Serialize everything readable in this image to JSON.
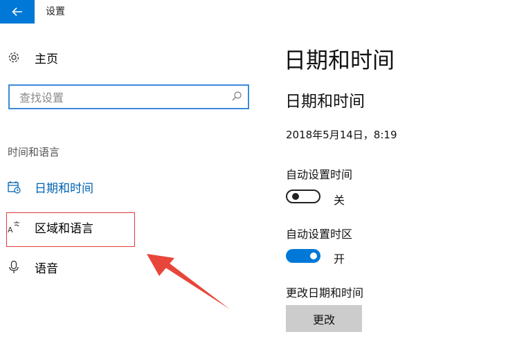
{
  "window": {
    "title": "设置"
  },
  "sidebar": {
    "home_label": "主页",
    "search_placeholder": "查找设置",
    "section_title": "时间和语言",
    "items": [
      {
        "label": "日期和时间",
        "icon": "calendar-clock-icon",
        "active": true
      },
      {
        "label": "区域和语言",
        "icon": "language-icon",
        "active": false
      },
      {
        "label": "语音",
        "icon": "microphone-icon",
        "active": false
      }
    ]
  },
  "main": {
    "page_title": "日期和时间",
    "section_title": "日期和时间",
    "current_datetime": "2018年5月14日，8:19",
    "auto_time": {
      "label": "自动设置时间",
      "state_label": "关",
      "on": false
    },
    "auto_timezone": {
      "label": "自动设置时区",
      "state_label": "开",
      "on": true
    },
    "change_datetime": {
      "label": "更改日期和时间",
      "button_label": "更改"
    }
  },
  "colors": {
    "accent": "#0078d7",
    "annotation": "#e03b3b",
    "button_bg": "#cccccc"
  }
}
